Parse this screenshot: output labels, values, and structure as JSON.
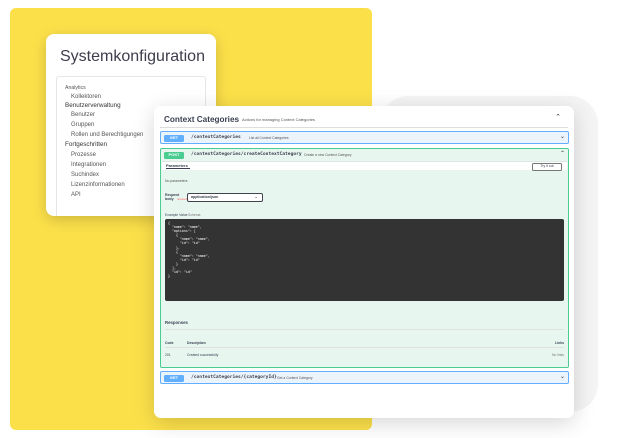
{
  "sysconfig": {
    "title": "Systemkonfiguration",
    "items": [
      {
        "label": "Analytics",
        "level": 0
      },
      {
        "label": "Kollektoren",
        "level": 1
      },
      {
        "label": "Benutzerverwaltung",
        "level": 0
      },
      {
        "label": "Benutzer",
        "level": 1
      },
      {
        "label": "Gruppen",
        "level": 1
      },
      {
        "label": "Rollen und Berechtigungen",
        "level": 1
      },
      {
        "label": "Fortgeschritten",
        "level": 0
      },
      {
        "label": "Prozesse",
        "level": 1
      },
      {
        "label": "Integrationen",
        "level": 1
      },
      {
        "label": "Suchindex",
        "level": 1
      },
      {
        "label": "Lizenzinformationen",
        "level": 1
      },
      {
        "label": "API",
        "level": 1
      }
    ]
  },
  "api": {
    "title": "Context Categories",
    "subtitle": "Actions for managing Context Categories",
    "colors": {
      "get": "#61affe",
      "post": "#49cc90",
      "code_bg": "#333333"
    },
    "operations": [
      {
        "method": "GET",
        "path": "/contextCategories",
        "desc": "List all Context Categories"
      },
      {
        "method": "POST",
        "path": "/contextCategories/createContextCategory",
        "desc": "Create a new Context Category"
      },
      {
        "method": "GET",
        "path": "/contextCategories/{categoryId}",
        "desc": "Get a Context Category"
      }
    ],
    "parameters_tab": "Parameters",
    "try_button": "Try it out",
    "no_params": "No parameters",
    "request_body_label": "Request body",
    "required_label": "required",
    "content_type": "application/json",
    "example_tabs": [
      "Example Value",
      "Schema"
    ],
    "example_code": "{\n  \"name\": \"name\",\n  \"options\": [\n    {\n      \"name\": \"name\",\n      \"id\": \"id\"\n    },\n    {\n      \"name\": \"name\",\n      \"id\": \"id\"\n    }\n  ],\n  \"id\": \"id\"\n}",
    "responses_title": "Responses",
    "response_headers": [
      "Code",
      "Description",
      "Links"
    ],
    "responses": [
      {
        "code": "201",
        "description": "Created successfully",
        "links": "No links"
      }
    ]
  }
}
